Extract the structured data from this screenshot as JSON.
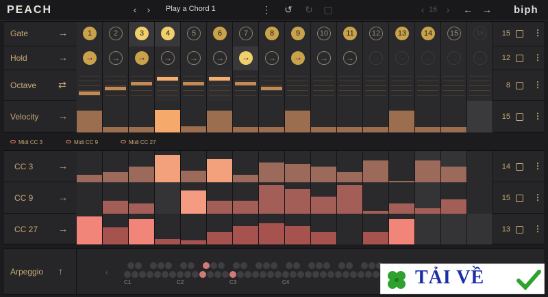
{
  "header": {
    "logo": "PEACH",
    "preset_name": "Play a Chord 1",
    "steps_count": "16",
    "brand": "biph"
  },
  "lanes": {
    "gate": {
      "label": "Gate",
      "count": "15"
    },
    "hold": {
      "label": "Hold",
      "count": "12"
    },
    "octave": {
      "label": "Octave",
      "count": "8"
    },
    "velocity": {
      "label": "Velocity",
      "count": "15"
    },
    "cc3": {
      "label": "CC 3",
      "count": "14"
    },
    "cc9": {
      "label": "CC 9",
      "count": "15"
    },
    "cc27": {
      "label": "CC 27",
      "count": "13"
    },
    "arp": {
      "label": "Arpeggio"
    }
  },
  "gate_steps": [
    "1",
    "2",
    "3",
    "4",
    "5",
    "6",
    "7",
    "8",
    "9",
    "10",
    "11",
    "12",
    "13",
    "14",
    "15",
    "16"
  ],
  "cc_tabs": [
    "Midi CC 3",
    "Midi CC 9",
    "Midi CC 27"
  ],
  "arp_octaves": [
    "C1",
    "C2",
    "C3",
    "C4"
  ],
  "watermark": {
    "text": "TẢI VỀ"
  },
  "chart_data": {
    "type": "bar",
    "categories": [
      "1",
      "2",
      "3",
      "4",
      "5",
      "6",
      "7",
      "8",
      "9",
      "10",
      "11",
      "12",
      "13",
      "14",
      "15",
      "16"
    ],
    "series": [
      {
        "name": "Velocity",
        "values": [
          0.75,
          0.2,
          0.2,
          0.78,
          0.22,
          0.75,
          0.2,
          0.2,
          0.75,
          0.2,
          0.2,
          0.2,
          0.75,
          0.2,
          0.2,
          0.0
        ]
      },
      {
        "name": "CC 3",
        "values": [
          0.25,
          0.35,
          0.55,
          0.95,
          0.4,
          0.8,
          0.25,
          0.7,
          0.65,
          0.55,
          0.35,
          0.75,
          0.05,
          0.75,
          0.55,
          0.0
        ]
      },
      {
        "name": "CC 9",
        "values": [
          0.0,
          0.45,
          0.35,
          0.0,
          0.8,
          0.45,
          0.45,
          1.0,
          0.85,
          0.6,
          1.0,
          0.1,
          0.35,
          0.2,
          0.5,
          0.0
        ]
      },
      {
        "name": "CC 27",
        "values": [
          1.0,
          0.6,
          0.9,
          0.2,
          0.15,
          0.45,
          0.65,
          0.75,
          0.65,
          0.45,
          0.0,
          0.45,
          0.9,
          0.0,
          0.0,
          0.0
        ]
      }
    ],
    "gate_state": [
      "on",
      "off",
      "hi",
      "hi",
      "off",
      "on",
      "off",
      "on",
      "on",
      "off",
      "on",
      "off",
      "on",
      "on",
      "off",
      "faint"
    ],
    "hold_state": [
      "on",
      "off",
      "on",
      "off",
      "off",
      "off",
      "hi",
      "off",
      "on",
      "off",
      "off",
      "faint",
      "faint",
      "faint",
      "faint",
      "faint"
    ],
    "octave_values": [
      1,
      2,
      3,
      4,
      3,
      4,
      3,
      2,
      0,
      0,
      0,
      0,
      0,
      0,
      0,
      0
    ]
  }
}
